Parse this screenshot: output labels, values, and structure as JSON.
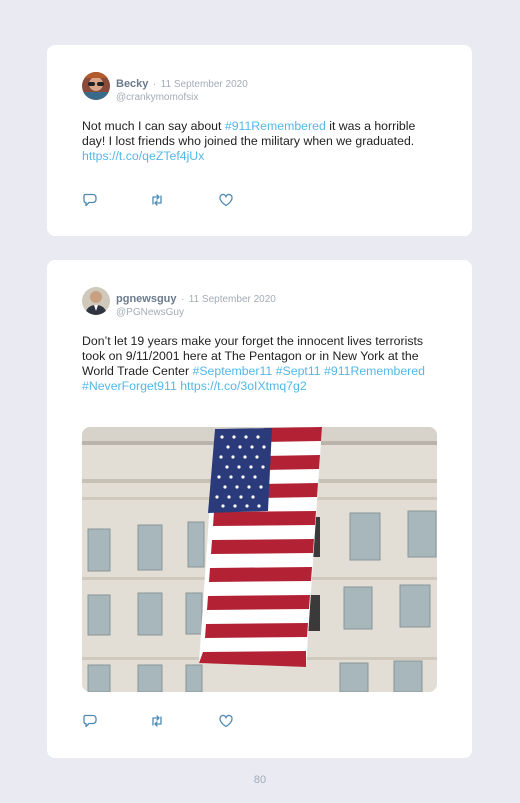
{
  "tweets": [
    {
      "name": "Becky",
      "separator": "·",
      "date": "11 September 2020",
      "handle": "@crankymomofsix",
      "segments": [
        {
          "t": "Not much I can say about ",
          "link": false
        },
        {
          "t": "#911Remembered",
          "link": true
        },
        {
          "t": " it was a horrible day! I lost friends who joined the military when we graduated. ",
          "link": false
        },
        {
          "t": "https://t.co/qeZTef4jUx",
          "link": true
        }
      ],
      "actions": [
        "reply-icon",
        "retweet-icon",
        "like-icon"
      ]
    },
    {
      "name": "pgnewsguy",
      "separator": "·",
      "date": "11 September 2020",
      "handle": "@PGNewsGuy",
      "segments": [
        {
          "t": "Don’t let 19 years make your forget the innocent lives terrorists took on 9/11/2001 here at The Pentagon or in New York at the World Trade Center ",
          "link": false
        },
        {
          "t": "#September11",
          "link": true
        },
        {
          "t": " ",
          "link": false
        },
        {
          "t": "#Sept11",
          "link": true
        },
        {
          "t": " ",
          "link": false
        },
        {
          "t": "#911Remembered",
          "link": true
        },
        {
          "t": " ",
          "link": false
        },
        {
          "t": "#NeverForget911",
          "link": true
        },
        {
          "t": " ",
          "link": false
        },
        {
          "t": "https://t.co/3oIXtmq7g2",
          "link": true
        }
      ],
      "actions": [
        "reply-icon",
        "retweet-icon",
        "like-icon"
      ]
    }
  ],
  "page_number": "80",
  "colors": {
    "background": "#e9eaf2",
    "link": "#53b8e6",
    "muted": "#a3acb6",
    "name": "#6b7b8c"
  }
}
